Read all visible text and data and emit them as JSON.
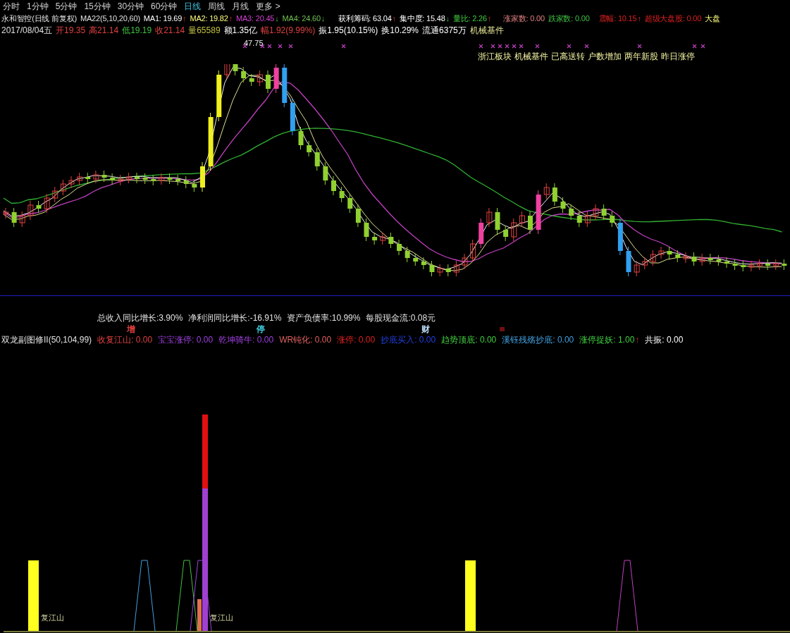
{
  "period_tabs": [
    {
      "label": "分时",
      "selected": false
    },
    {
      "label": "1分钟",
      "selected": false
    },
    {
      "label": "5分钟",
      "selected": false
    },
    {
      "label": "15分钟",
      "selected": false
    },
    {
      "label": "30分钟",
      "selected": false
    },
    {
      "label": "60分钟",
      "selected": false
    },
    {
      "label": "日线",
      "selected": true
    },
    {
      "label": "周线",
      "selected": false
    },
    {
      "label": "月线",
      "selected": false
    },
    {
      "label": "更多 >",
      "selected": false
    }
  ],
  "header": {
    "title": "永和智控(日线 前复权)",
    "params": "MA22(5,10,20,60)",
    "indicators": [
      {
        "label": "MA1: 19.69",
        "arrow": {
          "text": "↑",
          "kind": "up"
        }
      },
      {
        "label": "MA2: 19.82",
        "arrow": {
          "text": "↑",
          "kind": "up"
        }
      },
      {
        "label": "MA3: 20.45",
        "arrow": {
          "text": "↓",
          "kind": "down"
        }
      },
      {
        "label": "MA4: 24.60",
        "arrow": {
          "text": "↓",
          "kind": "down"
        }
      },
      {
        "label": "获利筹码: 63.04",
        "arrow": {
          "text": "↑",
          "kind": "up"
        }
      },
      {
        "label": "集中度: 15.48",
        "arrow": {
          "text": "↓",
          "kind": "down"
        }
      },
      {
        "label": "量比: 2.26",
        "arrow": {
          "text": "↑",
          "kind": "up"
        }
      },
      {
        "label": "涨家数: 0.00"
      },
      {
        "label": "跌家数: 0.00"
      },
      {
        "label": "震幅: 10.15",
        "arrow": {
          "text": "↑",
          "kind": "up"
        }
      },
      {
        "label": "超级大盘股: 0.00"
      },
      {
        "label": "大盘"
      }
    ]
  },
  "quote": {
    "date": "2017/08/04五",
    "fields": [
      {
        "label": "开",
        "value": "19.35",
        "color": "#e04040"
      },
      {
        "label": "高",
        "value": "21.14",
        "color": "#e04040"
      },
      {
        "label": "低",
        "value": "19.19",
        "color": "#40c040"
      },
      {
        "label": "收",
        "value": "21.14",
        "color": "#e04040"
      },
      {
        "label": "量",
        "value": "65589",
        "color": "#c0c040"
      },
      {
        "label": "额",
        "value": "1.35亿",
        "color": "#ffffff"
      },
      {
        "label": "幅",
        "value": "1.92(9.99%)",
        "color": "#e04040"
      },
      {
        "label": "振",
        "value": "1.95(10.15%)",
        "color": "#ffffff"
      },
      {
        "label": "换",
        "value": "10.29%",
        "color": "#ffffff"
      },
      {
        "label": "流通",
        "value": "6375万",
        "color": "#ffffff"
      }
    ],
    "sector": "机械基件"
  },
  "tags": [
    "浙江板块",
    "机械基件",
    "已高送转",
    "户数增加",
    "两年新股",
    "昨日涨停"
  ],
  "peak_price": "47.75",
  "financials": [
    "总收入同比增长:3.90%",
    "净利润同比增长:-16.91%",
    "资产负债率:10.99%",
    "每股现金流:0.08元"
  ],
  "event_markers": [
    {
      "text": "增",
      "color": "#e04040"
    },
    {
      "text": "停",
      "color": "#40d0e0"
    },
    {
      "text": "财",
      "color": "#c0e0ff"
    }
  ],
  "indicator": {
    "title": "双龙副图修II(50,104,99)",
    "lines": [
      {
        "label": "收复江山: 0.00"
      },
      {
        "label": "宝宝涨停: 0.00"
      },
      {
        "label": "乾坤骑牛: 0.00"
      },
      {
        "label": "WR钝化: 0.00"
      },
      {
        "label": "涨停: 0.00"
      },
      {
        "label": "抄底买入: 0.00"
      },
      {
        "label": "趋势顶底: 0.00"
      },
      {
        "label": "溪钰残殇抄底: 0.00"
      },
      {
        "label": "涨停捉妖: 1.00",
        "arrow": {
          "text": "↑",
          "kind": "up"
        }
      },
      {
        "label": "共振: 0.00"
      }
    ],
    "bar_labels": [
      "复江山",
      "复江山"
    ]
  }
}
